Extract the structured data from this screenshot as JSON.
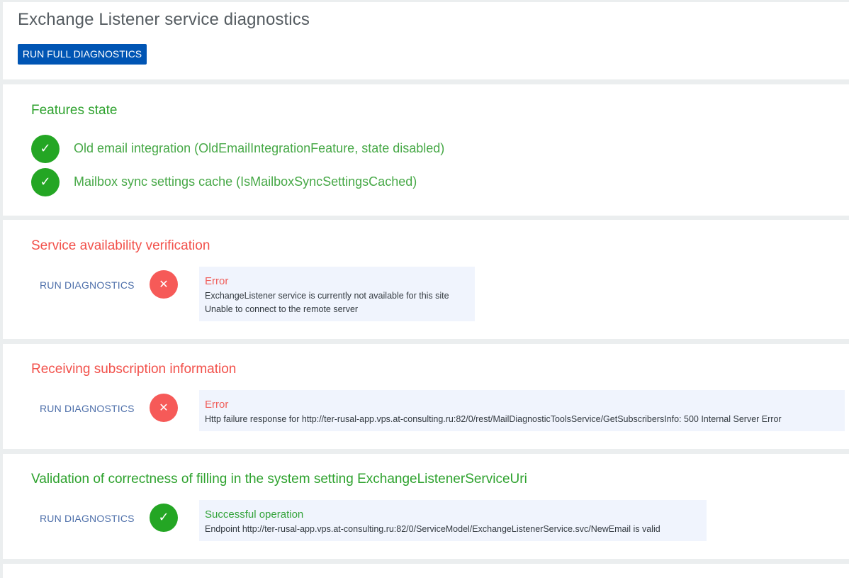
{
  "header": {
    "title": "Exchange Listener service diagnostics",
    "run_full_label": "RUN FULL DIAGNOSTICS"
  },
  "features": {
    "title": "Features state",
    "items": [
      {
        "status": "ok",
        "label": "Old email integration (OldEmailIntegrationFeature, state disabled)"
      },
      {
        "status": "ok",
        "label": "Mailbox sync settings cache (IsMailboxSyncSettingsCached)"
      }
    ]
  },
  "availability": {
    "title": "Service availability verification",
    "run_label": "RUN DIAGNOSTICS",
    "status": "error",
    "result_title": "Error",
    "result_lines": [
      "ExchangeListener service is currently not available for this site",
      "Unable to connect to the remote server"
    ]
  },
  "subscription": {
    "title": "Receiving subscription information",
    "run_label": "RUN DIAGNOSTICS",
    "status": "error",
    "result_title": "Error",
    "result_lines": [
      "Http failure response for http://ter-rusal-app.vps.at-consulting.ru:82/0/rest/MailDiagnosticToolsService/GetSubscribersInfo: 500 Internal Server Error"
    ]
  },
  "validation": {
    "title": "Validation of correctness of filling in the system setting ExchangeListenerServiceUri",
    "run_label": "RUN DIAGNOSTICS",
    "status": "ok",
    "result_title": "Successful operation",
    "result_lines": [
      "Endpoint http://ter-rusal-app.vps.at-consulting.ru:82/0/ServiceModel/ExchangeListenerService.svc/NewEmail is valid"
    ]
  },
  "icons": {
    "check": "✓",
    "cross": "✕"
  },
  "colors": {
    "primary": "#0055b4",
    "success": "#24a624",
    "error": "#f65a58",
    "link": "#4d6faa"
  }
}
